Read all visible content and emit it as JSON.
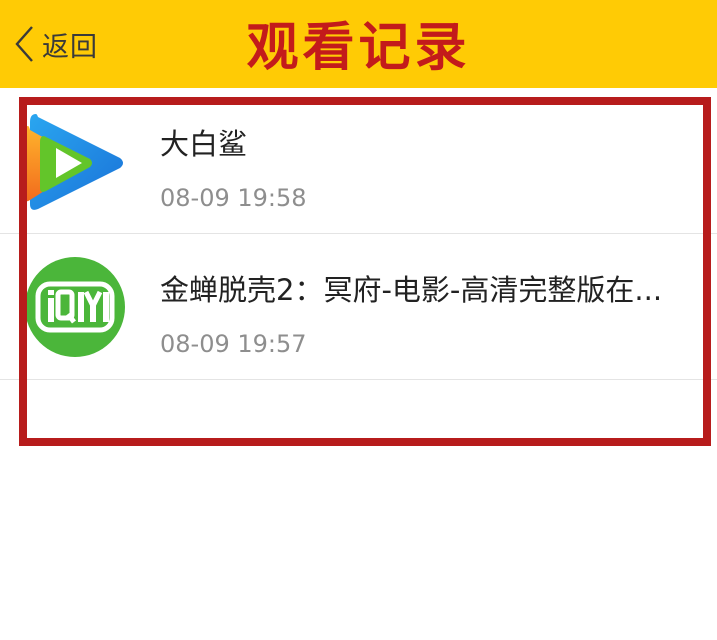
{
  "header": {
    "back_label": "返回",
    "title": "观看记录",
    "background_color": "#ffcb05",
    "title_color": "#c31b1b"
  },
  "history": [
    {
      "title": "大白鲨",
      "time": "08-09 19:58",
      "app_icon": "tencent-video-icon"
    },
    {
      "title": "金蝉脱壳2：冥府-电影-高清完整版在...",
      "time": "08-09 19:57",
      "app_icon": "iqiyi-icon"
    }
  ],
  "highlight_color": "#b71c1c"
}
